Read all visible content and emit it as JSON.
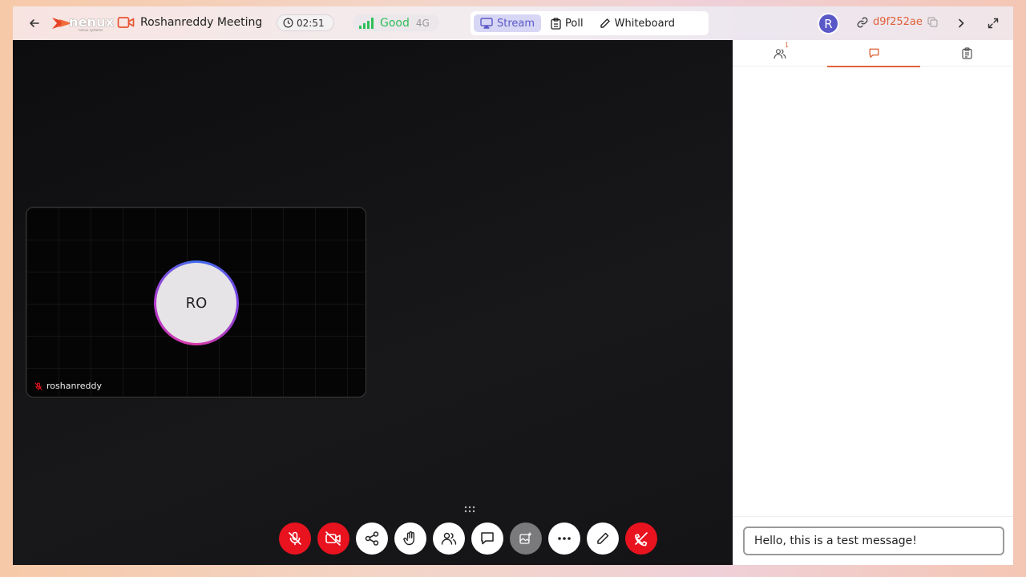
{
  "colors": {
    "accent": "#e0613a",
    "stream_active": "#5a58c8",
    "end_red": "#e8131f",
    "good": "#2fbf5a",
    "avatar": "#5b59c7"
  },
  "header": {
    "back_icon": "arrow-left-icon",
    "logo_text": "nenux",
    "logo_sub": "nenux systems",
    "meeting_icon": "video-camera-icon",
    "meeting_title": "Roshanreddy Meeting",
    "timer": "02:51",
    "network_quality": "Good",
    "network_type": "4G",
    "modes": [
      {
        "label": "Stream",
        "icon": "cast-icon",
        "active": true
      },
      {
        "label": "Poll",
        "icon": "clipboard-icon",
        "active": false
      },
      {
        "label": "Whiteboard",
        "icon": "pencil-icon",
        "active": false
      }
    ],
    "user_initial": "R",
    "meeting_id": "d9f252ae"
  },
  "stage": {
    "participant_initials": "RO",
    "participant_name": "roshanreddy",
    "controls": [
      {
        "name": "mic-off",
        "icon": "mic-off-icon"
      },
      {
        "name": "camera-off",
        "icon": "camera-off-icon"
      },
      {
        "name": "share",
        "icon": "share-icon"
      },
      {
        "name": "raise-hand",
        "icon": "hand-icon"
      },
      {
        "name": "participants",
        "icon": "users-icon"
      },
      {
        "name": "chat",
        "icon": "chat-icon"
      },
      {
        "name": "background",
        "icon": "image-plus-icon"
      },
      {
        "name": "more",
        "icon": "more-horizontal-icon"
      },
      {
        "name": "annotate",
        "icon": "pencil-icon"
      },
      {
        "name": "end-call",
        "icon": "phone-off-icon"
      }
    ]
  },
  "sidebar": {
    "tabs": [
      {
        "name": "participants",
        "icon": "users-icon",
        "badge": "1"
      },
      {
        "name": "chat",
        "icon": "chat-icon",
        "active": true
      },
      {
        "name": "notes",
        "icon": "clipboard-icon"
      }
    ],
    "chat_input_value": "Hello, this is a test message!"
  }
}
